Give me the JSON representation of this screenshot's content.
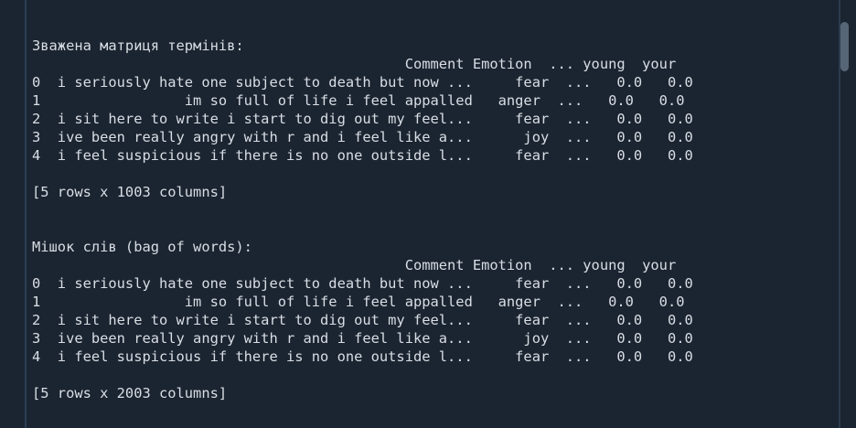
{
  "output_lines": [
    "",
    "Зважена матриця термінів:",
    "                                            Comment Emotion  ... young  your",
    "0  i seriously hate one subject to death but now ...     fear  ...   0.0   0.0",
    "1                 im so full of life i feel appalled   anger  ...   0.0   0.0",
    "2  i sit here to write i start to dig out my feel...     fear  ...   0.0   0.0",
    "3  ive been really angry with r and i feel like a...      joy  ...   0.0   0.0",
    "4  i feel suspicious if there is no one outside l...     fear  ...   0.0   0.0",
    "",
    "[5 rows x 1003 columns]",
    "",
    "",
    "Мішок слів (bag of words):",
    "                                            Comment Emotion  ... young  your",
    "0  i seriously hate one subject to death but now ...     fear  ...   0.0   0.0",
    "1                 im so full of life i feel appalled   anger  ...   0.0   0.0",
    "2  i sit here to write i start to dig out my feel...     fear  ...   0.0   0.0",
    "3  ive been really angry with r and i feel like a...      joy  ...   0.0   0.0",
    "4  i feel suspicious if there is no one outside l...     fear  ...   0.0   0.0",
    "",
    "[5 rows x 2003 columns]"
  ],
  "colors": {
    "background": "#1b2531",
    "text": "#d9dee5",
    "scrollbar_thumb": "#566676"
  }
}
